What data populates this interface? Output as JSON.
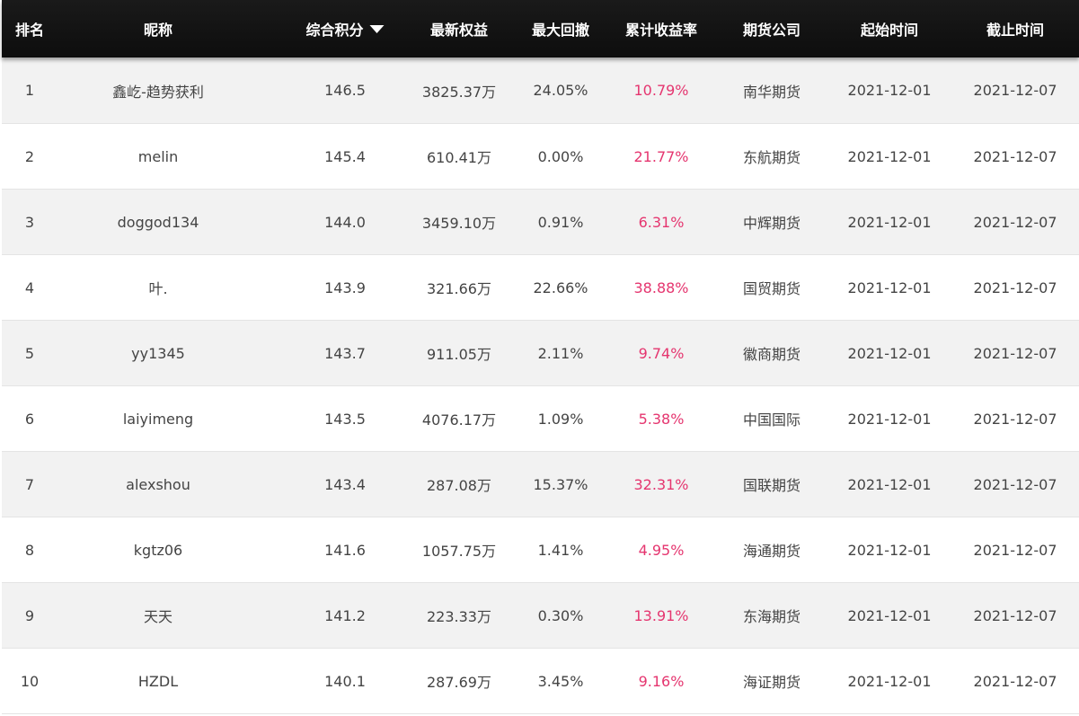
{
  "header": {
    "rank": "排名",
    "nickname": "昵称",
    "score": "综合积分",
    "equity": "最新权益",
    "drawdown": "最大回撤",
    "return": "累计收益率",
    "company": "期货公司",
    "start": "起始时间",
    "end": "截止时间"
  },
  "sort": {
    "column": "综合积分",
    "direction": "descending",
    "icon": "triangle-down-icon"
  },
  "colors": {
    "header_bg": "#111111",
    "return_text": "#e5356f",
    "row_alt": "#f2f2f2"
  },
  "rows": [
    {
      "rank": "1",
      "nickname": "鑫屹-趋势获利",
      "score": "146.5",
      "equity": "3825.37万",
      "drawdown": "24.05%",
      "return": "10.79%",
      "company": "南华期货",
      "start": "2021-12-01",
      "end": "2021-12-07"
    },
    {
      "rank": "2",
      "nickname": "melin",
      "score": "145.4",
      "equity": "610.41万",
      "drawdown": "0.00%",
      "return": "21.77%",
      "company": "东航期货",
      "start": "2021-12-01",
      "end": "2021-12-07"
    },
    {
      "rank": "3",
      "nickname": "doggod134",
      "score": "144.0",
      "equity": "3459.10万",
      "drawdown": "0.91%",
      "return": "6.31%",
      "company": "中辉期货",
      "start": "2021-12-01",
      "end": "2021-12-07"
    },
    {
      "rank": "4",
      "nickname": "叶.",
      "score": "143.9",
      "equity": "321.66万",
      "drawdown": "22.66%",
      "return": "38.88%",
      "company": "国贸期货",
      "start": "2021-12-01",
      "end": "2021-12-07"
    },
    {
      "rank": "5",
      "nickname": "yy1345",
      "score": "143.7",
      "equity": "911.05万",
      "drawdown": "2.11%",
      "return": "9.74%",
      "company": "徽商期货",
      "start": "2021-12-01",
      "end": "2021-12-07"
    },
    {
      "rank": "6",
      "nickname": "laiyimeng",
      "score": "143.5",
      "equity": "4076.17万",
      "drawdown": "1.09%",
      "return": "5.38%",
      "company": "中国国际",
      "start": "2021-12-01",
      "end": "2021-12-07"
    },
    {
      "rank": "7",
      "nickname": "alexshou",
      "score": "143.4",
      "equity": "287.08万",
      "drawdown": "15.37%",
      "return": "32.31%",
      "company": "国联期货",
      "start": "2021-12-01",
      "end": "2021-12-07"
    },
    {
      "rank": "8",
      "nickname": "kgtz06",
      "score": "141.6",
      "equity": "1057.75万",
      "drawdown": "1.41%",
      "return": "4.95%",
      "company": "海通期货",
      "start": "2021-12-01",
      "end": "2021-12-07"
    },
    {
      "rank": "9",
      "nickname": "天天",
      "score": "141.2",
      "equity": "223.33万",
      "drawdown": "0.30%",
      "return": "13.91%",
      "company": "东海期货",
      "start": "2021-12-01",
      "end": "2021-12-07"
    },
    {
      "rank": "10",
      "nickname": "HZDL",
      "score": "140.1",
      "equity": "287.69万",
      "drawdown": "3.45%",
      "return": "9.16%",
      "company": "海证期货",
      "start": "2021-12-01",
      "end": "2021-12-07"
    }
  ]
}
